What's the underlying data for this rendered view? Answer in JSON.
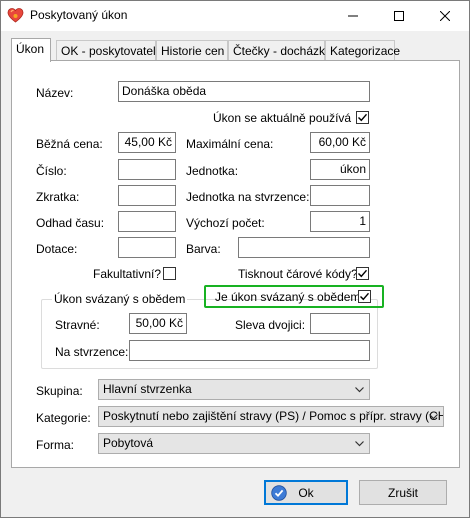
{
  "window": {
    "title": "Poskytovaný úkon",
    "minimize_glyph": "—",
    "maximize_glyph": "☐",
    "close_glyph": "✕"
  },
  "tabs": [
    {
      "label": "Úkon",
      "active": true
    },
    {
      "label": "OK - poskytovatel",
      "active": false
    },
    {
      "label": "Historie cen",
      "active": false
    },
    {
      "label": "Čtečky - docházka",
      "active": false
    },
    {
      "label": "Kategorizace",
      "active": false
    }
  ],
  "form": {
    "nazev_label": "Název:",
    "nazev_value": "Donáška oběda",
    "aktualne_label": "Úkon se aktuálně používá",
    "aktualne_checked": true,
    "bezna_cena_label": "Běžná cena:",
    "bezna_cena_value": "45,00 Kč",
    "max_cena_label": "Maximální cena:",
    "max_cena_value": "60,00 Kč",
    "cislo_label": "Číslo:",
    "cislo_value": "",
    "jednotka_label": "Jednotka:",
    "jednotka_value": "úkon",
    "zkratka_label": "Zkratka:",
    "zkratka_value": "",
    "jednotka_stvrzenka_label": "Jednotka na stvrzence:",
    "jednotka_stvrzenka_value": "",
    "odhad_label": "Odhad času:",
    "odhad_value": "",
    "vychozi_pocet_label": "Výchozí počet:",
    "vychozi_pocet_value": "1",
    "dotace_label": "Dotace:",
    "dotace_value": "",
    "barva_label": "Barva:",
    "barva_value": "",
    "fakultativni_label": "Fakultativní?",
    "fakultativni_checked": false,
    "tisknout_label": "Tisknout čárové kódy?",
    "tisknout_checked": true
  },
  "group": {
    "title": "Úkon svázaný s obědem",
    "je_ukon_label": "Je úkon svázaný s obědem?",
    "je_ukon_checked": true,
    "stravne_label": "Stravné:",
    "stravne_value": "50,00 Kč",
    "sleva_label": "Sleva dvojici:",
    "sleva_value": "",
    "na_stvrzence_label": "Na stvrzence:",
    "na_stvrzence_value": ""
  },
  "selects": {
    "skupina_label": "Skupina:",
    "skupina_value": "Hlavní stvrzenka",
    "kategorie_label": "Kategorie:",
    "kategorie_value": "Poskytnutí nebo zajištění stravy (PS) / Pomoc s přípr. stravy (CHD)",
    "forma_label": "Forma:",
    "forma_value": "Pobytová"
  },
  "buttons": {
    "ok_label": "Ok",
    "cancel_label": "Zrušit"
  },
  "colors": {
    "highlight": "#18b222",
    "accent": "#0078d7"
  }
}
